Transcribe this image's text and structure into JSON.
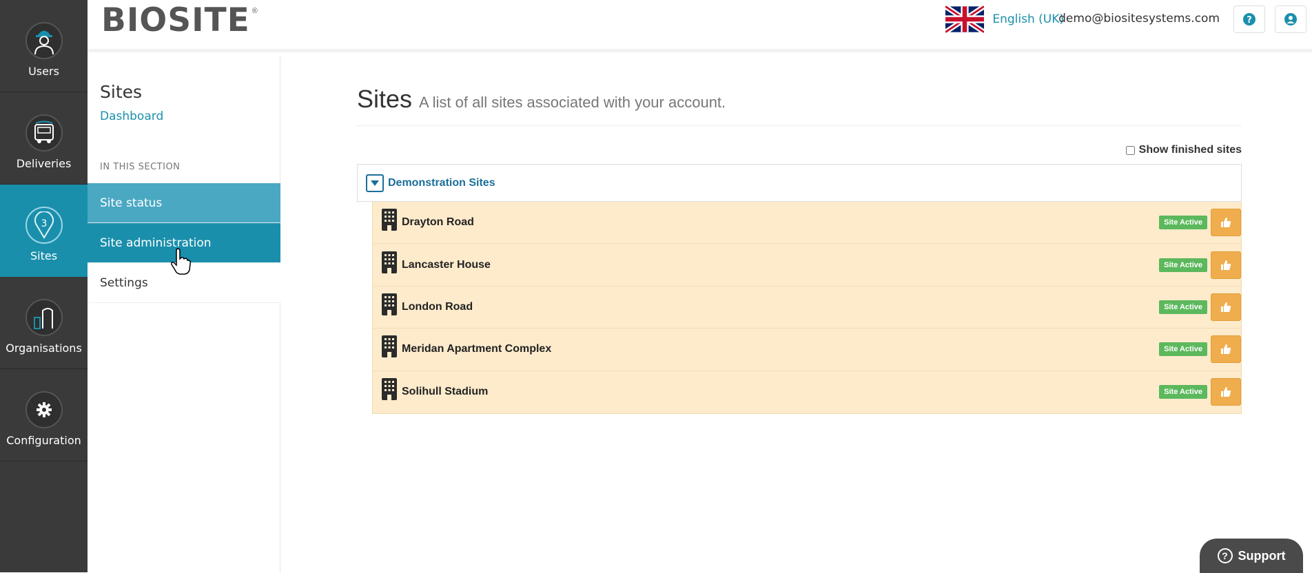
{
  "nav": {
    "items": [
      {
        "label": "Users",
        "icon": "worker-icon"
      },
      {
        "label": "Deliveries",
        "icon": "truck-icon"
      },
      {
        "label": "Sites",
        "icon": "map-pin-icon",
        "active": true
      },
      {
        "label": "Organisations",
        "icon": "buildings-icon"
      },
      {
        "label": "Configuration",
        "icon": "gear-icon"
      }
    ]
  },
  "header": {
    "logo": "BIOSITE",
    "logo_mark": "®",
    "language": "English (UK)",
    "user_email": "demo@biositesystems.com"
  },
  "section": {
    "title": "Sites",
    "dashboard_link": "Dashboard",
    "in_this_section": "IN THIS SECTION",
    "menu": [
      "Site status",
      "Site administration",
      "Settings"
    ]
  },
  "main": {
    "title": "Sites",
    "subtitle": "A list of all sites associated with your account.",
    "show_finished_label": "Show finished sites",
    "group_label": "Demonstration Sites",
    "sites": [
      {
        "name": "Drayton Road",
        "status": "Site Active"
      },
      {
        "name": "Lancaster House",
        "status": "Site Active"
      },
      {
        "name": "London Road",
        "status": "Site Active"
      },
      {
        "name": "Meridan Apartment Complex",
        "status": "Site Active"
      },
      {
        "name": "Solihull Stadium",
        "status": "Site Active"
      }
    ]
  },
  "support": {
    "label": "Support"
  },
  "colors": {
    "nav_bg": "#3a3a3a",
    "accent": "#1a8fac",
    "row_bg": "#fdebcc",
    "badge_green": "#5cb85c",
    "button_orange": "#f0ad4e"
  }
}
